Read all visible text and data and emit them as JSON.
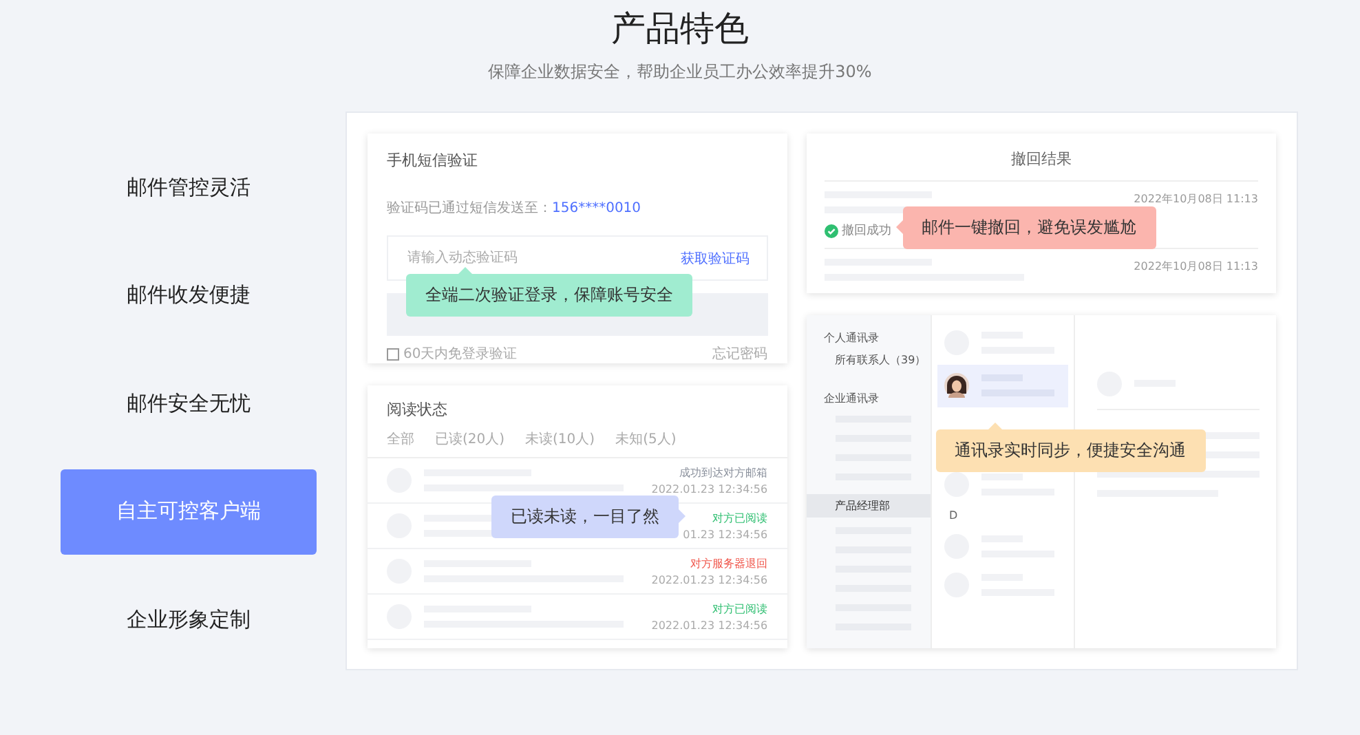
{
  "header": {
    "title": "产品特色",
    "subtitle": "保障企业数据安全，帮助企业员工办公效率提升30%"
  },
  "menu": [
    {
      "label": "邮件管控灵活",
      "selected": false
    },
    {
      "label": "邮件收发便捷",
      "selected": false
    },
    {
      "label": "邮件安全无忧",
      "selected": false
    },
    {
      "label": "自主可控客户端",
      "selected": true
    },
    {
      "label": "企业形象定制",
      "selected": false
    }
  ],
  "sms_card": {
    "title": "手机短信验证",
    "sent_label": "验证码已通过短信发送至：",
    "phone": "156****0010",
    "code_placeholder": "请输入动态验证码",
    "get_code": "获取验证码",
    "remember": {
      "label": "60天内免登录验证",
      "checked": false
    },
    "forgot": "忘记密码",
    "callout": {
      "text": "全端二次验证登录，保障账号安全",
      "color": "#a0ecd0"
    }
  },
  "read_card": {
    "title": "阅读状态",
    "tabs": [
      {
        "label": "全部",
        "selected": false
      },
      {
        "label": "已读(20人)",
        "selected": false
      },
      {
        "label": "未读(10人)",
        "selected": false
      },
      {
        "label": "未知(5人)",
        "selected": false
      }
    ],
    "rows": [
      {
        "status": "成功到达对方邮箱",
        "kind": "delivered",
        "time": "2022.01.23 12:34:56"
      },
      {
        "status": "对方已阅读",
        "kind": "read",
        "time": "01.23 12:34:56"
      },
      {
        "status": "对方服务器退回",
        "kind": "bounced",
        "time": "2022.01.23 12:34:56"
      },
      {
        "status": "对方已阅读",
        "kind": "read",
        "time": "2022.01.23 12:34:56"
      }
    ],
    "callout": {
      "text": "已读未读，一目了然",
      "color": "#cfd7fb"
    }
  },
  "recall_card": {
    "title": "撤回结果",
    "times": [
      "2022年10月08日 11:13",
      "2022年10月08日 11:13"
    ],
    "success": "撤回成功",
    "callout": {
      "text": "邮件一键撤回，避免误发尴尬",
      "color": "#fbb5ae"
    }
  },
  "contacts_card": {
    "personal": "个人通讯录",
    "all_contacts": "所有联系人（39）",
    "company": "企业通讯录",
    "department": {
      "label": "产品经理部",
      "selected": true
    },
    "letter": "D",
    "callout": {
      "text": "通讯录实时同步，便捷安全沟通",
      "color": "#fde0b2"
    }
  }
}
